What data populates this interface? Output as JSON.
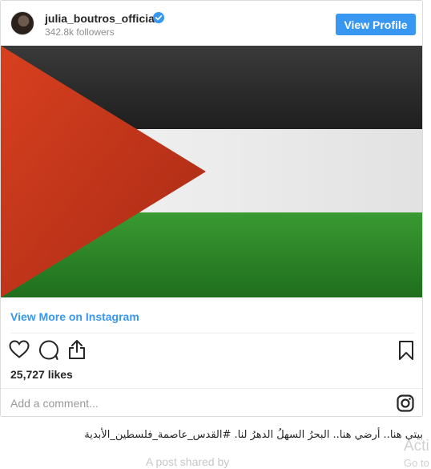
{
  "header": {
    "username": "julia_boutros_official",
    "followers": "342.8k followers",
    "view_profile_label": "View Profile"
  },
  "post": {
    "image": "palestinian-flag",
    "view_more_label": "View More on Instagram",
    "likes": "25,727 likes",
    "comment_placeholder": "Add a comment...",
    "caption": "بيتي هنا.. أرضي هنا.. البحرُ السهلُ الدهرُ لنا. #القدس_عاصمة_فلسطين_الأبدية"
  },
  "footer": {
    "shared_by": "A post shared by",
    "activate": "Acti",
    "goto": "Go to"
  },
  "colors": {
    "accent": "#3897f0",
    "flag_black": "#2a2a2a",
    "flag_white": "#eeeeee",
    "flag_green": "#2e8a2a",
    "flag_red": "#c8361c"
  },
  "icons": [
    "avatar",
    "verified-badge-icon",
    "heart-icon",
    "comment-icon",
    "share-icon",
    "bookmark-icon",
    "instagram-logo-icon"
  ]
}
